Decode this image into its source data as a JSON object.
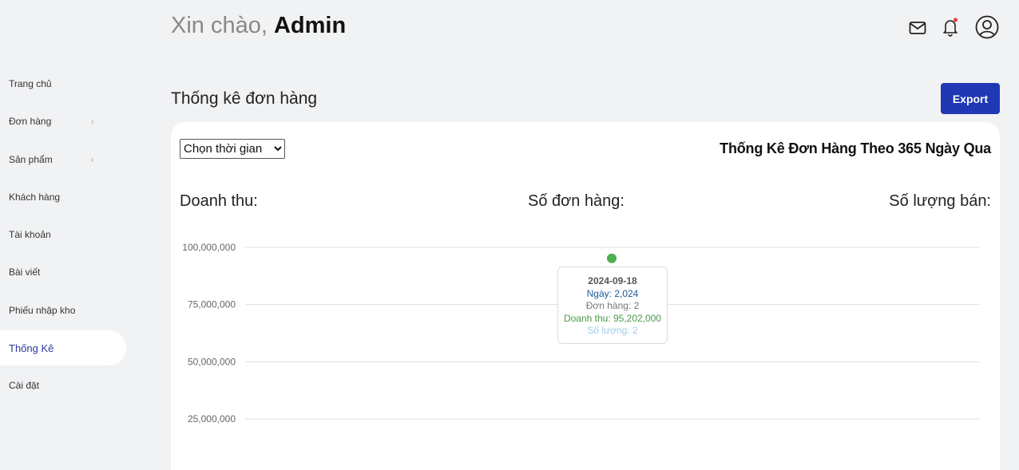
{
  "header": {
    "greeting_prefix": "Xin chào,",
    "greeting_name": "Admin"
  },
  "icons": {
    "mail": "mail-icon",
    "bell": "bell-icon",
    "user": "user-circle-icon"
  },
  "sidebar": {
    "items": [
      {
        "label": "Trang chủ"
      },
      {
        "label": "Đơn hàng",
        "chevron": "›"
      },
      {
        "label": "Sản phẩm",
        "chevron": "›"
      },
      {
        "label": "Khách hàng"
      },
      {
        "label": "Tài khoản"
      },
      {
        "label": "Bài viết"
      },
      {
        "label": "Phiếu nhập kho"
      },
      {
        "label": "Thống Kê",
        "active": true
      },
      {
        "label": "Cài đặt"
      }
    ]
  },
  "main": {
    "section_title": "Thống kê đơn hàng",
    "export_label": "Export",
    "select_value": "Chọn thời gian",
    "card_title": "Thống Kê Đơn Hàng Theo 365 Ngày Qua",
    "metrics": {
      "revenue": "Doanh thu:",
      "orders": "Số đơn hàng:",
      "quantity": "Số lượng bán:"
    }
  },
  "colors": {
    "accent": "#2038b4",
    "point": "#4caf50",
    "tooltip_date": "#555555",
    "tooltip_day": "#1a5a9a",
    "tooltip_orders": "#777777",
    "tooltip_revenue": "#4a9a4a",
    "tooltip_quantity": "#9ecbe8"
  },
  "chart_data": {
    "type": "scatter",
    "y_ticks": [
      "100,000,000",
      "75,000,000",
      "50,000,000",
      "25,000,000"
    ],
    "y_tick_values": [
      100000000,
      75000000,
      50000000,
      25000000
    ],
    "ylim": [
      0,
      100000000
    ],
    "grid": true,
    "points": [
      {
        "x": "2024-09-18",
        "y": 95202000
      }
    ],
    "tooltip": {
      "date": "2024-09-18",
      "day_label": "Ngày: 2,024",
      "orders_label": "Đơn hàng: 2",
      "revenue_label": "Doanh thu: 95,202,000",
      "quantity_label": "Số lượng: 2"
    }
  }
}
